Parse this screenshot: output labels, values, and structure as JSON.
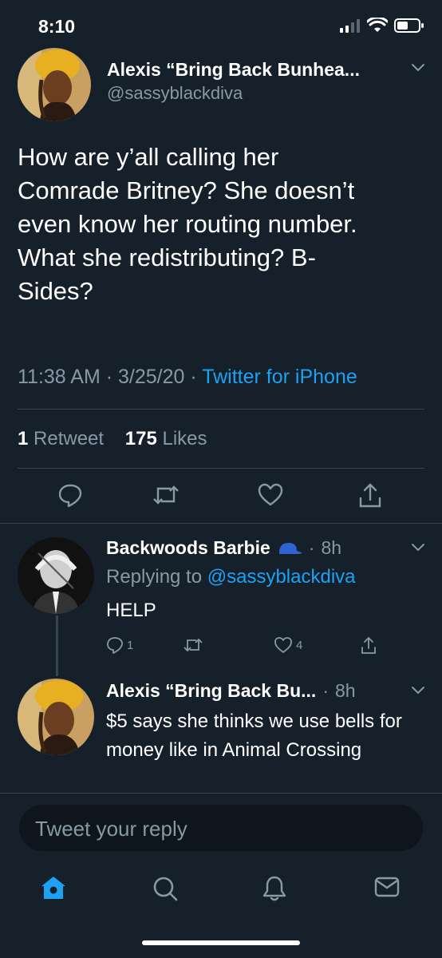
{
  "status_bar": {
    "time": "8:10"
  },
  "main_tweet": {
    "author_name": "Alexis “Bring Back Bunhea...",
    "handle": "@sassyblackdiva",
    "lines": [
      "How are y’all calling her",
      "Comrade Britney? She doesn’t",
      "even know her routing number.",
      "What she redistributing? B-",
      "Sides?"
    ],
    "time": "11:38 AM",
    "date": "3/25/20",
    "source": "Twitter for iPhone",
    "retweet_count": "1",
    "retweet_label": "Retweet",
    "like_count": "175",
    "like_label": "Likes"
  },
  "replies": [
    {
      "author_name": "Backwoods Barbie",
      "time": "8h",
      "replying_prefix": "Replying to",
      "replying_handle": "@sassyblackdiva",
      "text": "HELP",
      "reply_count": "1",
      "like_count": "4"
    },
    {
      "author_name": "Alexis “Bring Back Bu...",
      "time": "8h",
      "text": "$5 says she thinks we use bells for money like in Animal Crossing"
    }
  ],
  "composer": {
    "placeholder": "Tweet your reply"
  },
  "tabs": [
    "home-icon",
    "search-icon",
    "notifications-icon",
    "messages-icon"
  ],
  "colors": {
    "background": "#15202b",
    "accent": "#1da1f2",
    "muted": "#8899a6",
    "divider": "#38444d"
  }
}
